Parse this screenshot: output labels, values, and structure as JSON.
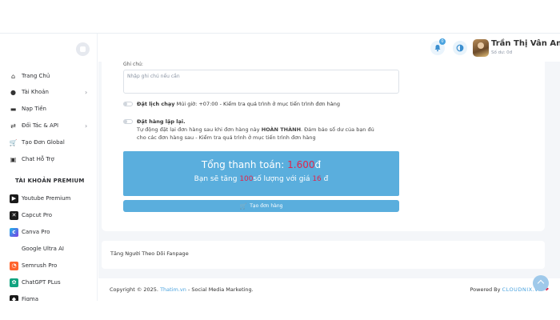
{
  "header": {
    "user_name": "Trần Thị Vân Anh",
    "balance_label": "Số dư: 0đ",
    "notification_count": "0"
  },
  "sidebar": {
    "items": [
      {
        "label": "Trang Chủ",
        "icon": "home-icon"
      },
      {
        "label": "Tài Khoản",
        "icon": "user-icon"
      },
      {
        "label": "Nạp Tiền",
        "icon": "wallet-icon"
      },
      {
        "label": "Đối Tác & API",
        "icon": "api-icon"
      },
      {
        "label": "Tạo Đơn Global",
        "icon": "cart-icon"
      },
      {
        "label": "Chat Hỗ Trợ",
        "icon": "chat-icon"
      }
    ],
    "premium_title": "TÀI KHOẢN PREMIUM",
    "premium_items": [
      {
        "label": "Youtube Premium",
        "color": "#1a1a1a"
      },
      {
        "label": "Capcut Pro",
        "color": "#1a1a1a"
      },
      {
        "label": "Canva Pro",
        "color": "#1fb6e8"
      },
      {
        "label": "Google Ultra AI",
        "color": "#ffffff"
      },
      {
        "label": "Semrush Pro",
        "color": "#ff642d"
      },
      {
        "label": "ChatGPT PLus",
        "color": "#10a37f"
      },
      {
        "label": "Figma",
        "color": "#1a1a1a"
      }
    ]
  },
  "form": {
    "note_label": "Ghi chú:",
    "note_placeholder": "Nhập ghi chú nếu cần",
    "schedule_title": "Đặt lịch chạy",
    "schedule_desc": "Múi giờ: +07:00 - Kiểm tra quá trình ở mục tiến trình đơn hàng",
    "repeat_title": "Đặt hàng lặp lại.",
    "repeat_desc_1a": "Tự động đặt lại đơn hàng sau khi đơn hàng này ",
    "repeat_desc_1b": "HOÀN THÀNH",
    "repeat_desc_1c": ". Đảm bảo số dư của bạn đủ",
    "repeat_desc_2": "cho các đơn hàng sau - Kiểm tra quá trình ở mục tiến trình đơn hàng"
  },
  "total": {
    "label": "Tổng thanh toán: ",
    "amount": "1.600",
    "currency": "đ",
    "line2_prefix": "Bạn sẽ tăng ",
    "quantity": "100",
    "line2_mid": "số lượng với giá ",
    "price": "16",
    "line2_suffix": " đ"
  },
  "create_button": "Tạo đơn hàng",
  "fanpage_title": "Tăng Người Theo Dõi Fanpage",
  "footer": {
    "copyright_prefix": "Copyright © 2025. ",
    "site": "Thatim.vn",
    "copyright_suffix": " - Social Media Marketing.",
    "powered_prefix": "Powered By ",
    "powered_brand": "CLOUDNIX.VN"
  },
  "colors": {
    "accent": "#5aaedd",
    "highlight": "#e0254d"
  }
}
